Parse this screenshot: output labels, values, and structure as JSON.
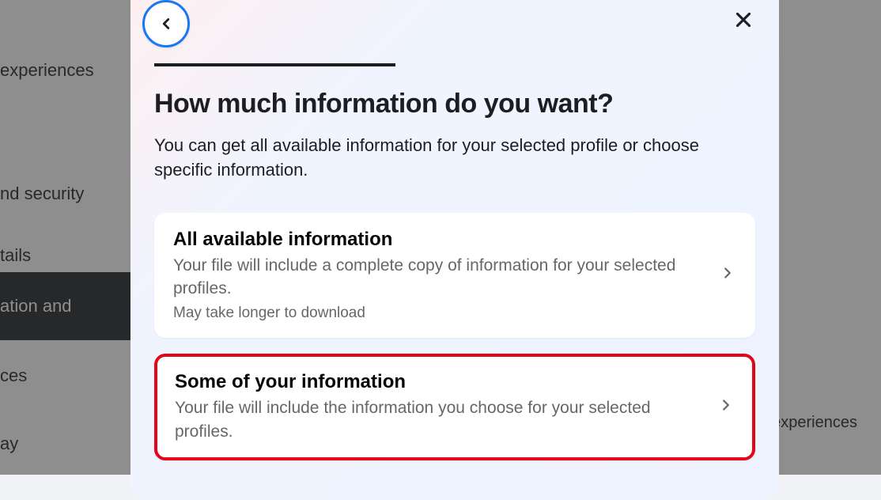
{
  "sidebar": {
    "items": [
      {
        "label": "experiences"
      },
      {
        "label": "nd security"
      },
      {
        "label": "tails"
      },
      {
        "label": "ation and"
      },
      {
        "label": "ces"
      },
      {
        "label": "ay"
      }
    ]
  },
  "right": {
    "text1": "ur experiences"
  },
  "modal": {
    "title": "How much information do you want?",
    "description": "You can get all available information for your selected profile or choose specific information.",
    "options": [
      {
        "title": "All available information",
        "desc": "Your file will include a complete copy of information for your selected profiles.",
        "note": "May take longer to download"
      },
      {
        "title": "Some of your information",
        "desc": "Your file will include the information you choose for your selected profiles."
      }
    ]
  }
}
